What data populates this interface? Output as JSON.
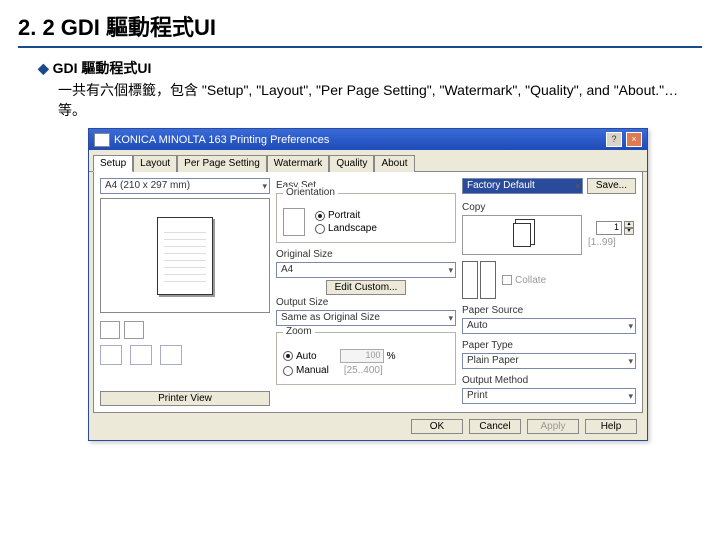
{
  "slide": {
    "heading": "2. 2 GDI 驅動程式UI",
    "bullet": "GDI 驅動程式UI",
    "desc": "一共有六個標籤，包含 \"Setup\", \"Layout\", \"Per Page Setting\", \"Watermark\", \"Quality\", and \"About.\"…等。"
  },
  "dialog": {
    "title": "KONICA MINOLTA 163 Printing Preferences",
    "help_btn": "?",
    "close_btn": "×",
    "tabs": [
      "Setup",
      "Layout",
      "Per Page Setting",
      "Watermark",
      "Quality",
      "About"
    ],
    "activeTab": "Setup",
    "left": {
      "paper_summary": "A4 (210 x 297 mm)",
      "printer_view_btn": "Printer View"
    },
    "mid": {
      "easyset_label": "Easy Set",
      "orientation_label": "Orientation",
      "orientation_portrait": "Portrait",
      "orientation_landscape": "Landscape",
      "original_size_label": "Original Size",
      "original_size_value": "A4",
      "edit_custom_btn": "Edit Custom...",
      "output_size_label": "Output Size",
      "output_size_value": "Same as Original Size",
      "zoom_label": "Zoom",
      "zoom_auto": "Auto",
      "zoom_auto_value": "100",
      "zoom_pct": "%",
      "zoom_manual": "Manual",
      "zoom_manual_range": "[25..400]"
    },
    "right": {
      "preset_value": "Factory Default",
      "save_btn": "Save...",
      "copy_label": "Copy",
      "copy_range": "[1..99]",
      "copy_value": "1",
      "collate_label": "Collate",
      "paper_source_label": "Paper Source",
      "paper_source_value": "Auto",
      "paper_type_label": "Paper Type",
      "paper_type_value": "Plain Paper",
      "output_method_label": "Output Method",
      "output_method_value": "Print"
    },
    "buttons": {
      "ok": "OK",
      "cancel": "Cancel",
      "apply": "Apply",
      "help": "Help"
    }
  }
}
